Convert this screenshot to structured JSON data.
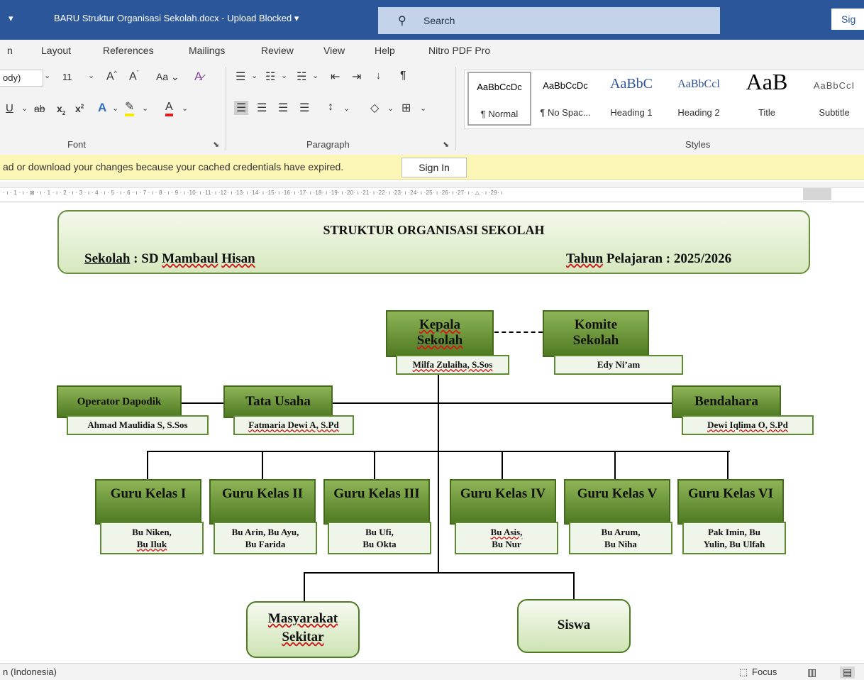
{
  "titlebar": {
    "qat_glyph": "▾",
    "doc_title": "BARU Struktur Organisasi Sekolah.docx  -  Upload Blocked  ▾",
    "search_label": "Search",
    "signin_label": "Sig"
  },
  "menu": {
    "items": [
      "n",
      "Layout",
      "References",
      "Mailings",
      "Review",
      "View",
      "Help",
      "Nitro PDF Pro"
    ]
  },
  "ribbon": {
    "font_name": "ody)",
    "font_size": "11",
    "group_font": "Font",
    "group_paragraph": "Paragraph",
    "group_styles": "Styles",
    "styles": [
      {
        "preview": "AaBbCcDc",
        "label": "¶ Normal"
      },
      {
        "preview": "AaBbCcDc",
        "label": "¶ No Spac..."
      },
      {
        "preview": "AaBbC",
        "label": "Heading 1"
      },
      {
        "preview": "AaBbCcl",
        "label": "Heading 2"
      },
      {
        "preview": "AaB",
        "label": "Title"
      },
      {
        "preview": "AaBbCcI",
        "label": "Subtitle"
      }
    ],
    "heading_color": "#2f5496"
  },
  "message_bar": {
    "text": "ad or download your changes because your cached credentials have expired.",
    "button": "Sign In"
  },
  "ruler": {
    "numbers": "· ı · 1 · ı · ⊠ · ı · 1 · ı · 2 · ı · 3 · ı · 4 · ı · 5 · ı · 6 · ı · 7 · ı · 8 · ı · 9 · ı ·10· ı ·11· ı ·12· ı ·13· ı ·14· ı ·15· ı ·16· ı ·17· ı ·18· ı ·19· ı ·20· ı ·21· ı ·22· ı ·23· ı ·24· ı ·25· ı ·26· ı ·27· ı · △ · ı ·29· ı"
  },
  "document": {
    "header": {
      "title": "STRUKTUR ORGANISASI SEKOLAH",
      "school_label": "Sekolah",
      "school_sep": " : ",
      "school_name_a": "SD ",
      "school_name_b": "Mambaul",
      "school_name_c": " ",
      "school_name_d": "Hisan",
      "year_label_a": "Tahun",
      "year_label_b": " Pelajaran  :  2025/2026"
    },
    "kepala": {
      "title": "Kepala Sekolah",
      "name": "Milfa Zulaiha, S.Sos"
    },
    "komite": {
      "title": "Komite Sekolah",
      "name": "Edy Ni’am"
    },
    "operator": {
      "title": "Operator Dapodik",
      "name": "Ahmad Maulidia S, S.Sos"
    },
    "tata_usaha": {
      "title": "Tata Usaha",
      "name": "Fatmaria Dewi A, S.Pd"
    },
    "bendahara": {
      "title": "Bendahara",
      "name": "Dewi Iqlima O, S.Pd"
    },
    "guru": [
      {
        "title": "Guru Kelas I",
        "name_l1": "Bu Niken,",
        "name_l2": "Bu Iluk"
      },
      {
        "title": "Guru Kelas II",
        "name_l1": "Bu Arin, Bu Ayu,",
        "name_l2": "Bu Farida"
      },
      {
        "title": "Guru Kelas III",
        "name_l1": "Bu Ufi,",
        "name_l2": "Bu Okta"
      },
      {
        "title": "Guru Kelas IV",
        "name_l1": "Bu Asis,",
        "name_l2": "Bu Nur"
      },
      {
        "title": "Guru Kelas V",
        "name_l1": "Bu Arum,",
        "name_l2": "Bu Niha"
      },
      {
        "title": "Guru Kelas VI",
        "name_l1": "Pak Imin, Bu",
        "name_l2": "Yulin, Bu Ulfah"
      }
    ],
    "masyarakat": "Masyarakat Sekitar",
    "siswa": "Siswa"
  },
  "statusbar": {
    "language": "n (Indonesia)",
    "focus": "Focus"
  }
}
